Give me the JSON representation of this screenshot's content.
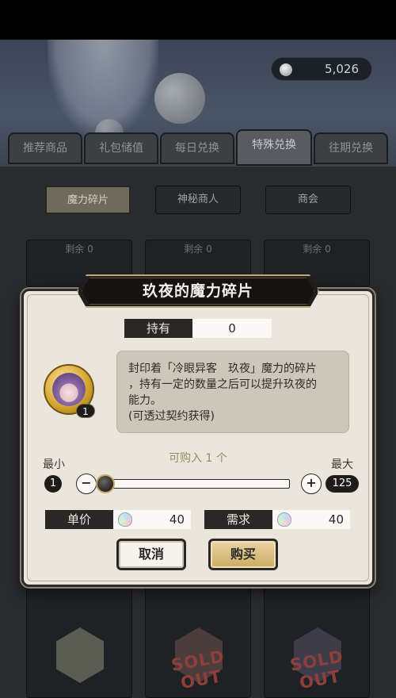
{
  "background": {
    "currency": {
      "icon": "gem-icon",
      "amount": "5,026"
    },
    "tabs": [
      {
        "label": "推荐商品",
        "active": false
      },
      {
        "label": "礼包储值",
        "active": false
      },
      {
        "label": "每日兑换",
        "active": false
      },
      {
        "label": "特殊兑换",
        "active": true
      },
      {
        "label": "往期兑换",
        "active": false
      }
    ],
    "subtabs": [
      {
        "label": "魔力碎片",
        "active": true
      },
      {
        "label": "神秘商人",
        "active": false
      },
      {
        "label": "商会",
        "active": false
      }
    ],
    "card_remaining": "剩余 0",
    "sold_out": "SOLD OUT"
  },
  "modal": {
    "title": "玖夜的魔力碎片",
    "hold_label": "持有",
    "hold_value": "0",
    "item_icon": "character-fragment-icon",
    "item_count": "1",
    "description_line1": "封印着「冷眼异客　玖夜」魔力的碎片",
    "description_line2": "，持有一定的数量之后可以提升玖夜的",
    "description_line3": "能力。",
    "description_line4": "(可透过契约获得)",
    "min_label": "最小",
    "max_label": "最大",
    "buyable_text": "可购入 1 个",
    "min_value": "1",
    "max_value": "125",
    "slider_level": 0,
    "minus_label": "−",
    "plus_label": "+",
    "unit_price_label": "单价",
    "unit_price_value": "40",
    "required_label": "需求",
    "required_value": "40",
    "price_icon": "crystal-icon",
    "cancel_label": "取消",
    "buy_label": "购买"
  },
  "colors": {
    "modal_bg": "#ebe6db",
    "dark_label": "#2a2826",
    "accent_gold": "#cdab62",
    "buyable_text": "#9b8a65"
  }
}
